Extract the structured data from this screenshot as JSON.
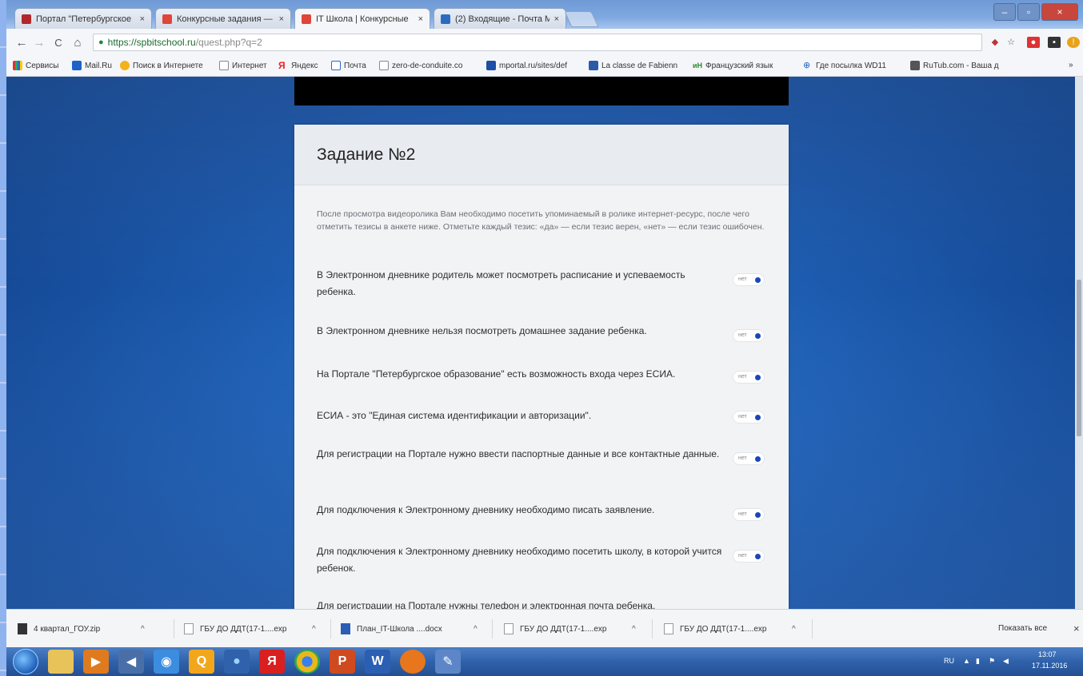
{
  "browser": {
    "tabs": [
      {
        "title": "Портал \"Петербургское",
        "active": false
      },
      {
        "title": "Конкурсные задания —",
        "active": false
      },
      {
        "title": "IT Школа | Конкурсные",
        "active": true
      },
      {
        "title": "(2) Входящие - Почта M",
        "active": false
      }
    ],
    "tab_close": "×",
    "window_controls": {
      "minimize": "–",
      "maximize": "▫",
      "close": "×"
    },
    "url": {
      "host": "https://spbitschool.ru",
      "path": "/quest.php?q=2"
    },
    "nav": {
      "back": "←",
      "forward": "→",
      "reload": "C",
      "home": "⌂"
    },
    "bookmarks": [
      "Сервисы",
      "Mail.Ru",
      "Поиск в Интернете",
      "Интернет",
      "Яндекс",
      "Почта",
      "zero-de-conduite.co",
      "mportal.ru/sites/def",
      "La classe de Fabienn",
      "Французский язык",
      "Где посылка WD11",
      "RuTub.com - Ваша д"
    ],
    "bookmarks_more": "»"
  },
  "quest": {
    "title": "Задание №2",
    "intro": "После просмотра видеоролика Вам необходимо посетить упоминаемый в ролике интернет-ресурс, после чего отметить тезисы в анкете ниже. Отметьте каждый тезис: «да» — если тезис верен, «нет» — если тезис ошибочен.",
    "toggle_label": "нет",
    "questions": [
      "В Электронном дневнике родитель может посмотреть расписание и успеваемость ребенка.",
      "В Электронном дневнике нельзя посмотреть домашнее задание ребенка.",
      "На Портале \"Петербургское образование\" есть возможность входа через ЕСИА.",
      "ЕСИА - это \"Единая система идентификации и авторизации\".",
      "Для регистрации на Портале нужно ввести паспортные данные и все контактные данные.",
      "Для подключения к Электронному дневнику необходимо писать заявление.",
      "Для подключения к Электронному дневнику необходимо посетить школу, в которой учится ребенок.",
      "Для регистрации на Портале нужны телефон и электронная почта ребенка."
    ]
  },
  "downloads": {
    "items": [
      "4 квартал_ГОУ.zip",
      "ГБУ ДО ДДТ(17-1....exp",
      "План_IT-Школа ....docx",
      "ГБУ ДО ДДТ(17-1....exp",
      "ГБУ ДО ДДТ(17-1....exp"
    ],
    "caret": "^",
    "show_all": "Показать все",
    "close": "×"
  },
  "taskbar": {
    "lang": "RU",
    "time": "13:07",
    "date": "17.11.2016"
  },
  "colors": {
    "accent": "#1a47b8",
    "page_bg": "#1e5eb3",
    "taskbar": "#2f62ab"
  }
}
